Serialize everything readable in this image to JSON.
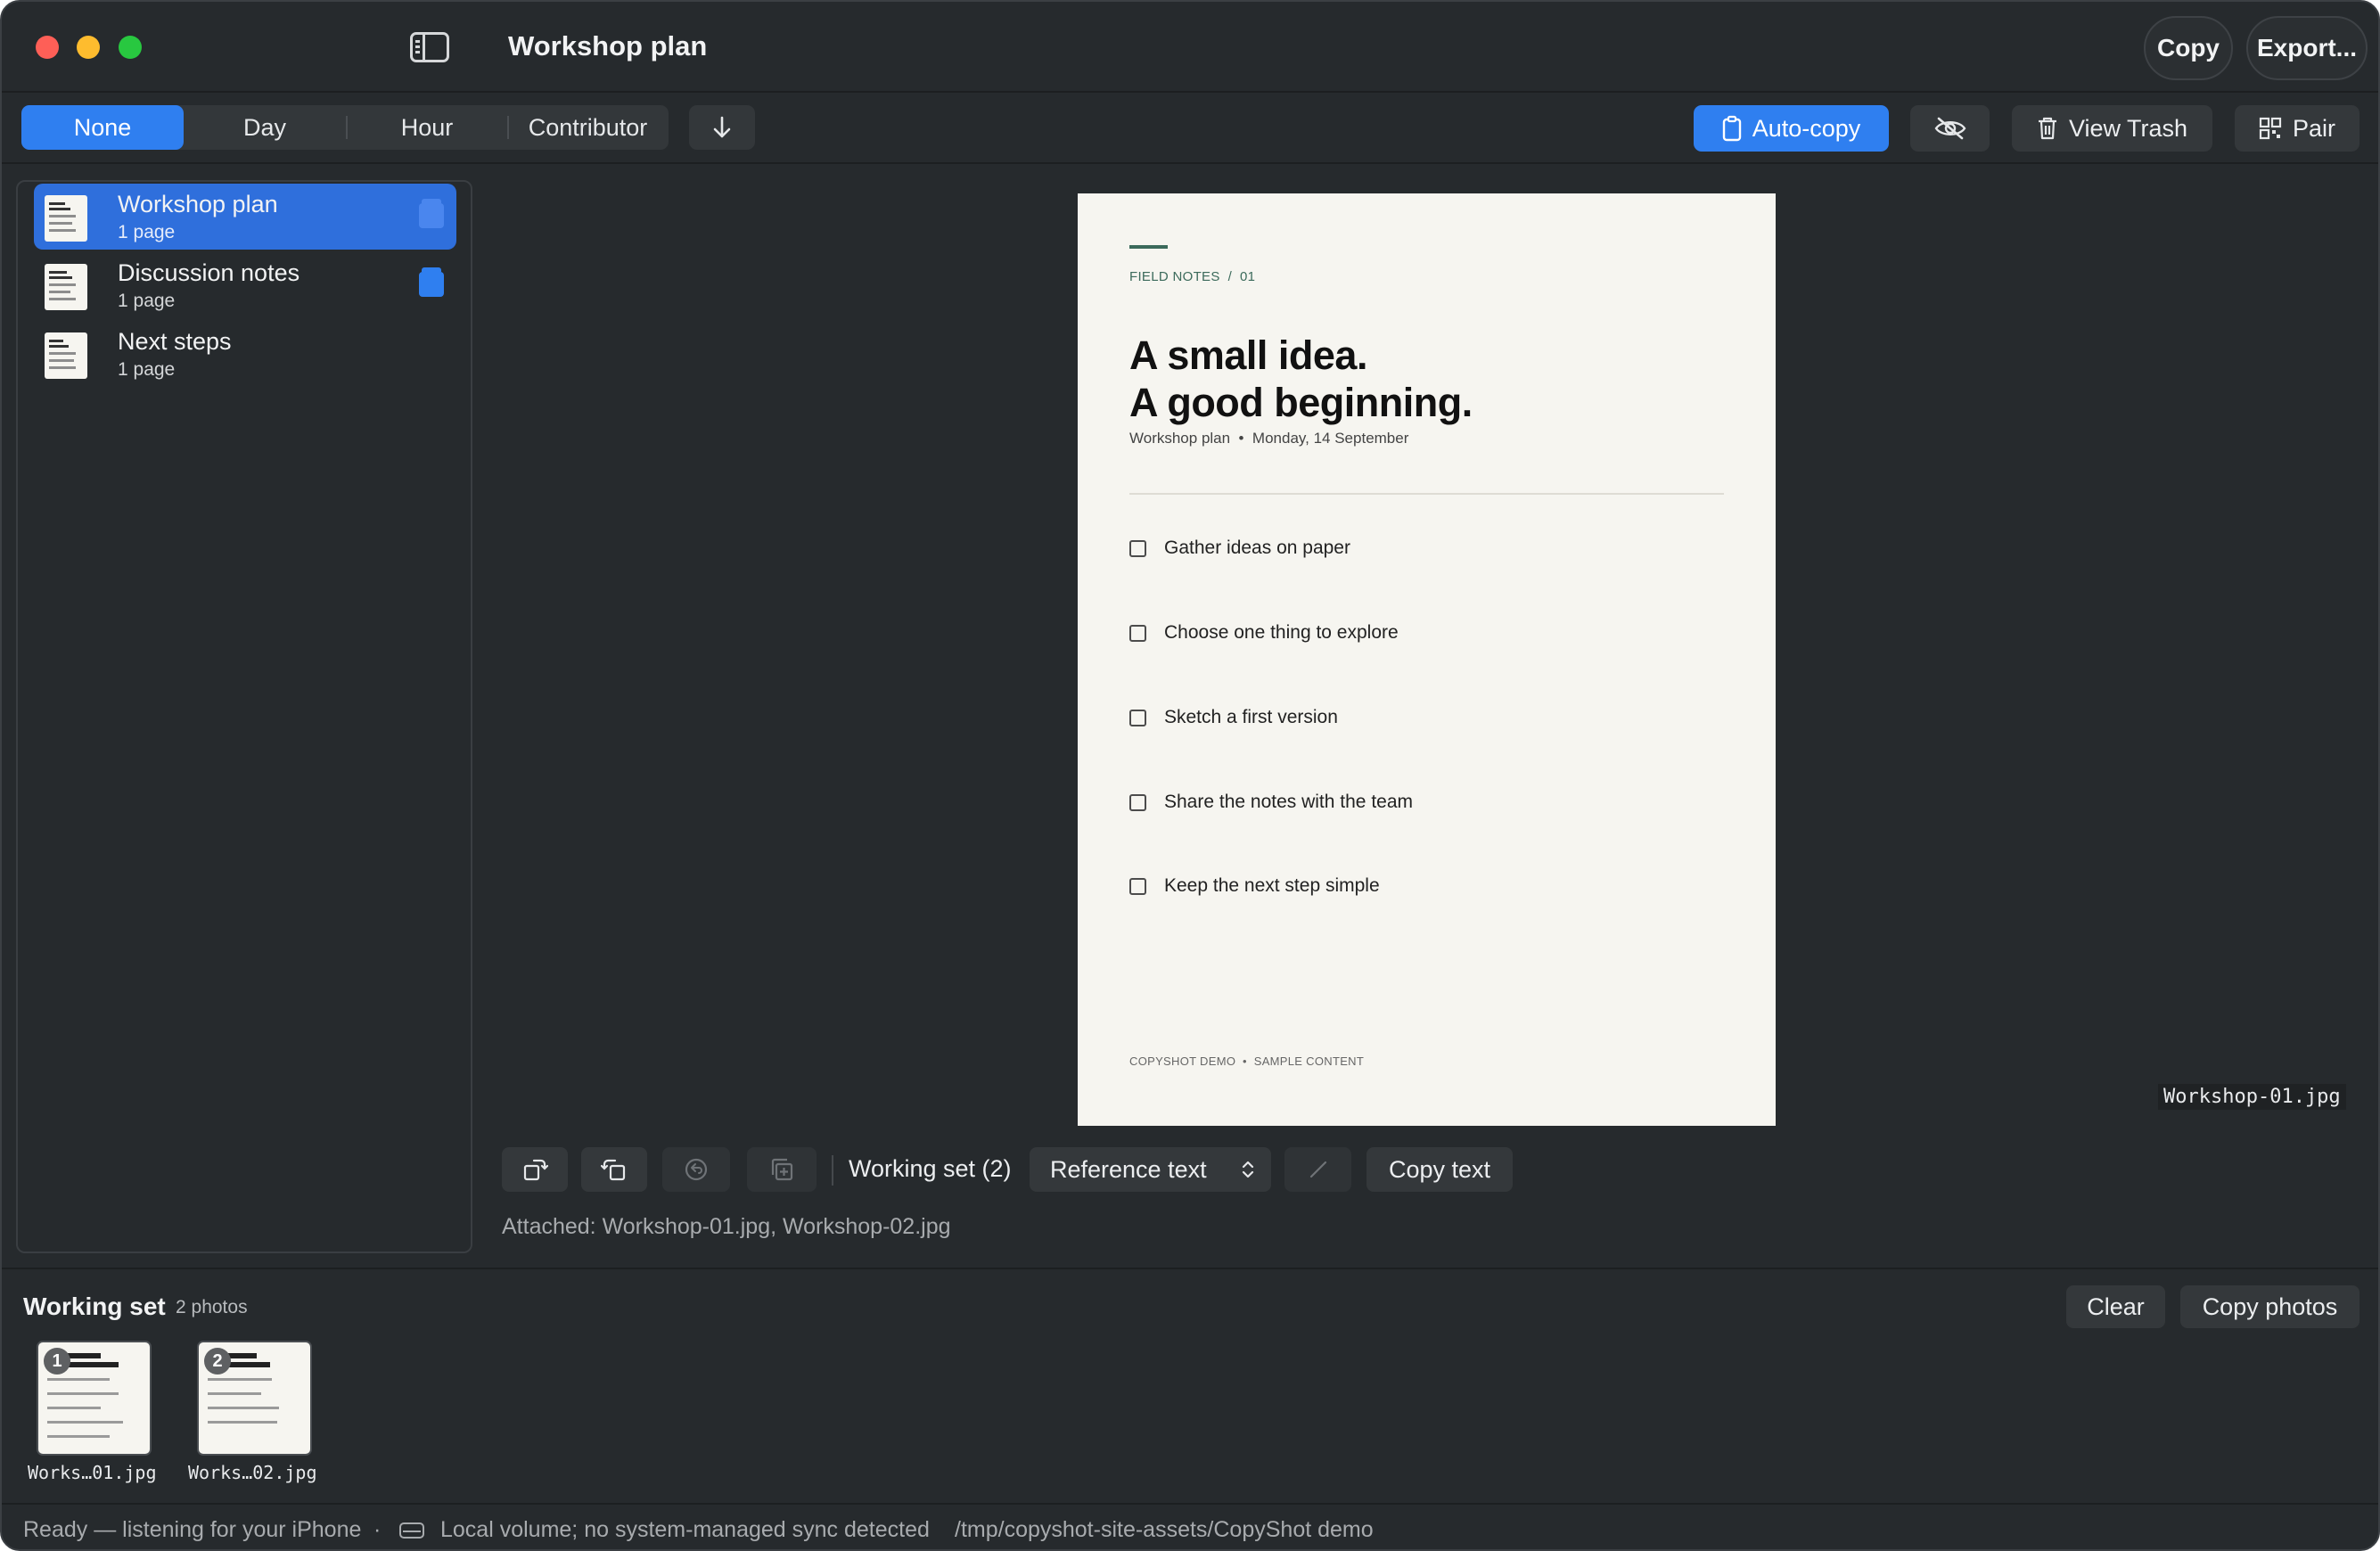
{
  "window": {
    "title": "Workshop plan"
  },
  "titlebar": {
    "copy_label": "Copy",
    "export_label": "Export..."
  },
  "toolbar": {
    "grouping": [
      "None",
      "Day",
      "Hour",
      "Contributor"
    ],
    "grouping_selected": "None",
    "autocopy_label": "Auto-copy",
    "view_trash_label": "View Trash",
    "pair_label": "Pair"
  },
  "documents": [
    {
      "title": "Workshop plan",
      "pages": "1 page",
      "selected": true,
      "in_working_set": true
    },
    {
      "title": "Discussion notes",
      "pages": "1 page",
      "selected": false,
      "in_working_set": true
    },
    {
      "title": "Next steps",
      "pages": "1 page",
      "selected": false,
      "in_working_set": false
    }
  ],
  "preview": {
    "eyebrow": "FIELD NOTES  /  01",
    "heading_line1": "A small idea.",
    "heading_line2": "A good beginning.",
    "meta": "Workshop plan  •  Monday, 14 September",
    "checklist": [
      "Gather ideas on paper",
      "Choose one thing to explore",
      "Sketch a first version",
      "Share the notes with the team",
      "Keep the next step simple"
    ],
    "footer": "COPYSHOT DEMO  •  SAMPLE CONTENT",
    "filename": "Workshop-01.jpg"
  },
  "controls": {
    "working_set_label": "Working set (2)",
    "reference_label": "Reference text",
    "copy_text_label": "Copy text",
    "attached": "Attached: Workshop-01.jpg, Workshop-02.jpg"
  },
  "working_set": {
    "title": "Working set",
    "count": "2 photos",
    "clear_label": "Clear",
    "copy_photos_label": "Copy photos",
    "items": [
      {
        "number": "1",
        "name": "Works…01.jpg"
      },
      {
        "number": "2",
        "name": "Works…02.jpg"
      }
    ]
  },
  "status": {
    "ready": "Ready — listening for your iPhone",
    "separator": "·",
    "volume": "Local volume; no system-managed sync detected",
    "path": "/tmp/copyshot-site-assets/CopyShot demo"
  },
  "colors": {
    "accent": "#2f7ff0",
    "window_bg": "#262a2d",
    "page_bg": "#f6f5f0",
    "page_accent": "#3b6a5b"
  },
  "icons": [
    "sidebar-toggle-icon",
    "sort-down-arrow-icon",
    "clipboard-icon",
    "eye-slash-icon",
    "trash-icon",
    "qr-code-icon",
    "rotate-right-icon",
    "rotate-left-icon",
    "revert-icon",
    "duplicate-icon",
    "chevron-up-down-icon",
    "pencil-icon",
    "drive-icon"
  ]
}
